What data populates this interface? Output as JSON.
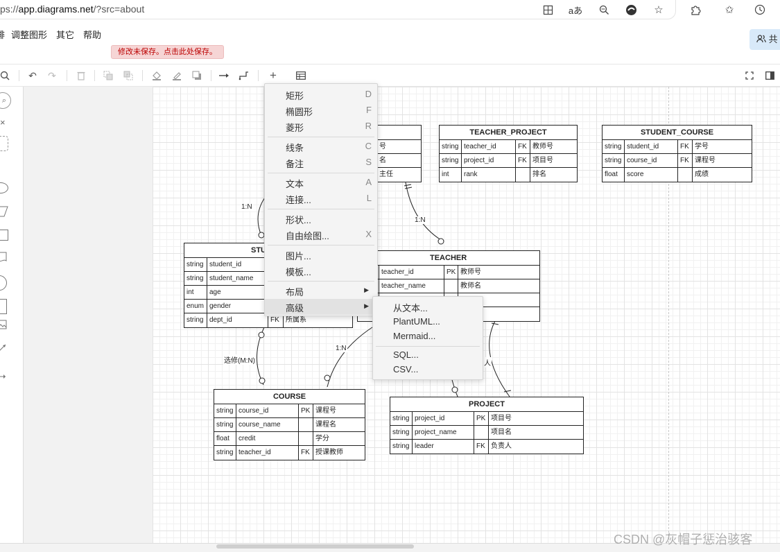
{
  "browser": {
    "url_prefix": "ps://",
    "url_host": "app.diagrams.net",
    "url_path": "/?src=about"
  },
  "menubar": {
    "items": [
      "排",
      "调整图形",
      "其它",
      "帮助"
    ],
    "unsaved_notice": "修改未保存。点击此处保存。",
    "share_label": "共"
  },
  "toolbar": {
    "icons": [
      "zoom-out-icon",
      "undo-icon",
      "redo-icon",
      "delete-icon",
      "to-front-icon",
      "to-back-icon",
      "fill-color-icon",
      "line-color-icon",
      "shadow-icon",
      "connection-icon",
      "waypoints-icon",
      "insert-icon",
      "table-icon",
      "fullscreen-icon",
      "format-panel-icon"
    ]
  },
  "diagram": {
    "tables": [
      {
        "name": "",
        "rows": [
          [
            "",
            "",
            "号"
          ],
          [
            "",
            "",
            "名"
          ],
          [
            "",
            "",
            "主任"
          ]
        ]
      },
      {
        "name": "TEACHER_PROJECT",
        "rows": [
          [
            "string",
            "teacher_id",
            "FK",
            "教师号"
          ],
          [
            "string",
            "project_id",
            "FK",
            "项目号"
          ],
          [
            "int",
            "rank",
            "",
            "排名"
          ]
        ]
      },
      {
        "name": "STUDENT_COURSE",
        "rows": [
          [
            "string",
            "student_id",
            "FK",
            "学号"
          ],
          [
            "string",
            "course_id",
            "FK",
            "课程号"
          ],
          [
            "float",
            "score",
            "",
            "成绩"
          ]
        ]
      },
      {
        "name": "STU",
        "rows": [
          [
            "string",
            "student_id"
          ],
          [
            "string",
            "student_name"
          ],
          [
            "int",
            "age"
          ],
          [
            "enum",
            "gender"
          ],
          [
            "string",
            "dept_id",
            "FK",
            "所属系"
          ]
        ]
      },
      {
        "name": "TEACHER",
        "rows": [
          [
            "teacher_id",
            "PK",
            "教师号"
          ],
          [
            "teacher_name",
            "",
            "教师名"
          ],
          [
            "",
            "",
            ""
          ],
          [
            "",
            "",
            ""
          ]
        ]
      },
      {
        "name": "COURSE",
        "rows": [
          [
            "string",
            "course_id",
            "PK",
            "课程号"
          ],
          [
            "string",
            "course_name",
            "",
            "课程名"
          ],
          [
            "float",
            "credit",
            "",
            "学分"
          ],
          [
            "string",
            "teacher_id",
            "FK",
            "授课教师"
          ]
        ]
      },
      {
        "name": "PROJECT",
        "rows": [
          [
            "string",
            "project_id",
            "PK",
            "项目号"
          ],
          [
            "string",
            "project_name",
            "",
            "项目名"
          ],
          [
            "string",
            "leader",
            "FK",
            "负责人"
          ]
        ]
      }
    ],
    "relation_labels": [
      "1:N",
      "1:N",
      "选修(M:N)",
      "1:N",
      "人"
    ]
  },
  "context_menu": {
    "items": [
      {
        "label": "矩形",
        "key": "D"
      },
      {
        "label": "椭圆形",
        "key": "F"
      },
      {
        "label": "菱形",
        "key": "R"
      },
      {
        "label": "线条",
        "key": "C"
      },
      {
        "label": "备注",
        "key": "S"
      },
      {
        "label": "文本",
        "key": "A"
      },
      {
        "label": "连接...",
        "key": "L"
      },
      {
        "label": "形状...",
        "key": ""
      },
      {
        "label": "自由绘图...",
        "key": "X"
      },
      {
        "label": "图片...",
        "key": ""
      },
      {
        "label": "模板...",
        "key": ""
      },
      {
        "label": "布局",
        "key": ""
      },
      {
        "label": "高级",
        "key": ""
      }
    ],
    "submenu_arrow": "▶",
    "highlighted": "高级"
  },
  "submenu": {
    "items": [
      "从文本...",
      "PlantUML...",
      "Mermaid...",
      "SQL...",
      "CSV..."
    ]
  },
  "watermark": "CSDN @灰帽子惩治骇客"
}
